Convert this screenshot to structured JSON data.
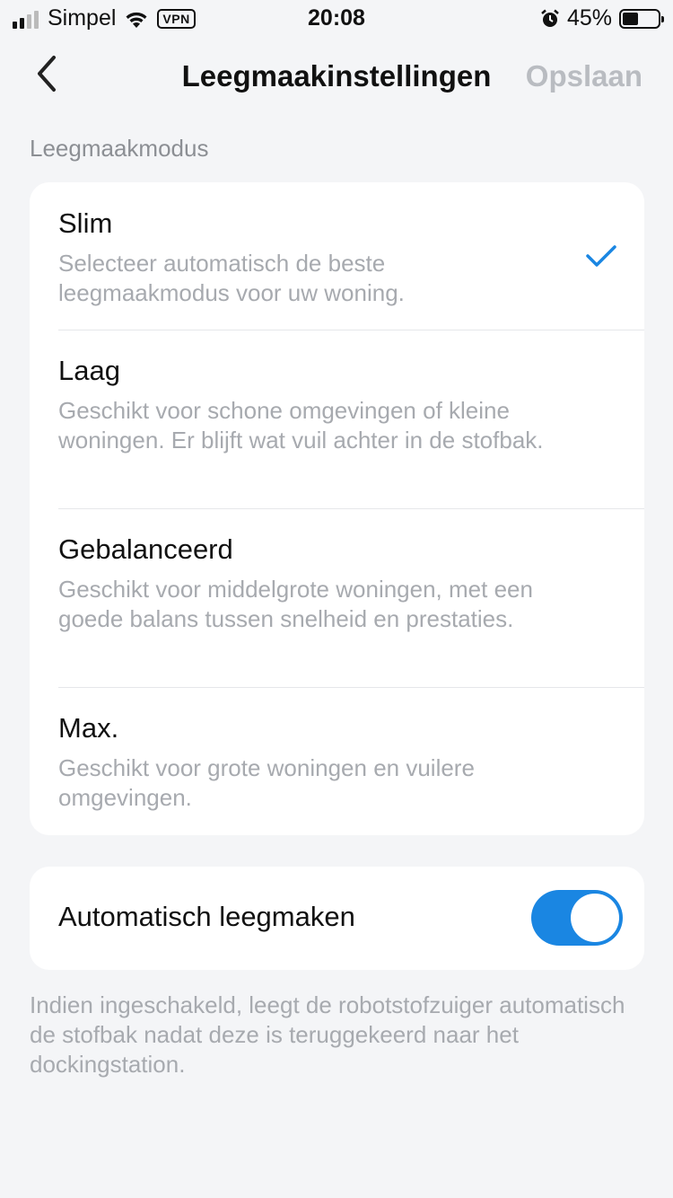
{
  "status_bar": {
    "carrier": "Simpel",
    "vpn": "VPN",
    "time": "20:08",
    "battery": "45%",
    "battery_level": 0.45,
    "icons": [
      "signal-icon",
      "wifi-icon",
      "alarm-icon",
      "battery-icon"
    ]
  },
  "nav": {
    "back_icon": "chevron-left-icon",
    "title": "Leegmaakinstellingen",
    "save_label": "Opslaan"
  },
  "section": {
    "label": "Leegmaakmodus"
  },
  "modes": [
    {
      "title": "Slim",
      "description": "Selecteer automatisch de beste leegmaakmodus voor uw woning.",
      "selected": true
    },
    {
      "title": "Laag",
      "description": "Geschikt voor schone omgevingen of kleine woningen. Er blijft wat vuil achter in de stofbak.",
      "selected": false
    },
    {
      "title": "Gebalanceerd",
      "description": "Geschikt voor middelgrote woningen, met een goede balans tussen snelheid en prestaties.",
      "selected": false
    },
    {
      "title": "Max.",
      "description": "Geschikt voor grote woningen en vuilere omgevingen.",
      "selected": false
    }
  ],
  "auto_empty": {
    "label": "Automatisch leegmaken",
    "enabled": true,
    "note": "Indien ingeschakeld, leegt de robotstofzuiger automatisch de stofbak nadat deze is teruggekeerd naar het dockingstation."
  },
  "colors": {
    "accent": "#1a86e2",
    "muted_text": "#a7aaaf",
    "background": "#f4f5f7"
  }
}
